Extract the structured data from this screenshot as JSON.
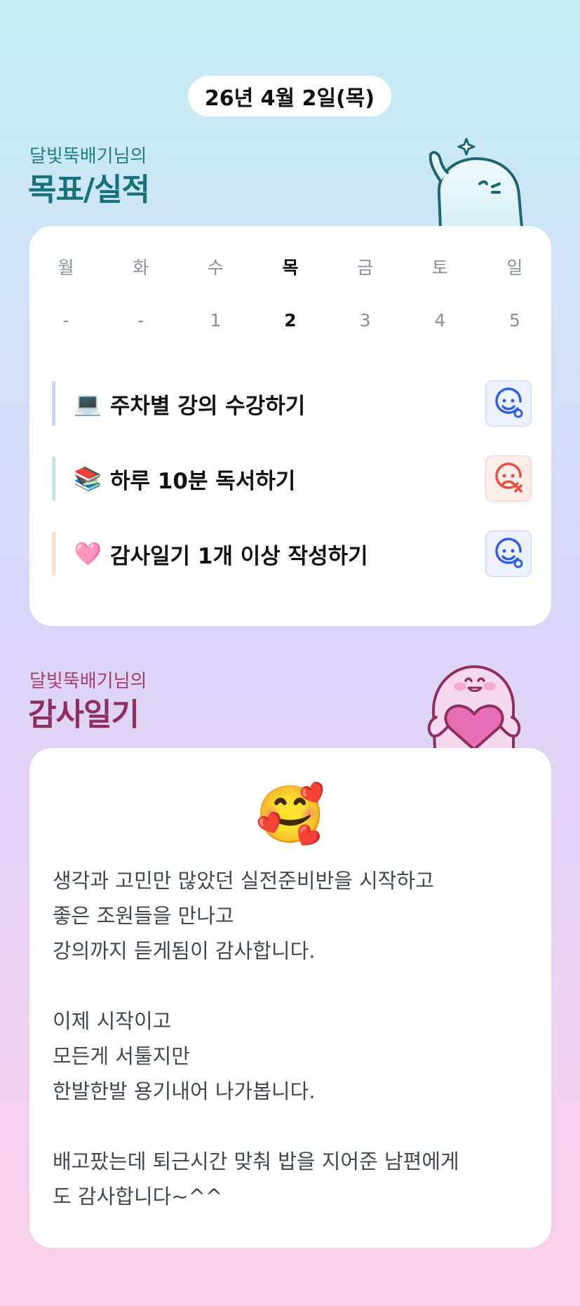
{
  "header": {
    "date": "26년 4월 2일(목)"
  },
  "goals_section": {
    "subtitle": "달빛뚝배기님의",
    "title": "목표/실적",
    "days": [
      {
        "label": "월",
        "date": "-"
      },
      {
        "label": "화",
        "date": "-"
      },
      {
        "label": "수",
        "date": "1"
      },
      {
        "label": "목",
        "date": "2",
        "active": true
      },
      {
        "label": "금",
        "date": "3"
      },
      {
        "label": "토",
        "date": "4"
      },
      {
        "label": "일",
        "date": "5"
      }
    ],
    "goals": [
      {
        "emoji": "💻",
        "text": "주차별 강의 수강하기",
        "status": "smile-check-icon",
        "bar_color": "#c8d3f5"
      },
      {
        "emoji": "📚",
        "text": "하루 10분 독서하기",
        "status": "frown-x-icon",
        "bar_color": "#bfe9df"
      },
      {
        "emoji": "🩷",
        "text": "감사일기 1개 이상 작성하기",
        "status": "smile-check-icon",
        "bar_color": "#fbe0c4"
      }
    ]
  },
  "diary_section": {
    "subtitle": "달빛뚝배기님의",
    "title": "감사일기",
    "emoji": "🥰",
    "text": "생각과 고민만 많았던 실전준비반을 시작하고\n좋은 조원들을 만나고\n강의까지 듣게됨이 감사합니다.\n\n이제 시작이고\n모든게 서툴지만\n한발한발 용기내어 나가봅니다.\n\n배고팠는데 퇴근시간 맞춰 밥을 지어준 남편에게\n도 감사합니다~^^"
  },
  "colors": {
    "accent_blue": "#2f5fe0",
    "fail_red": "#e4503a",
    "teal_title": "#1f7f86",
    "plum_title": "#8e2f5f"
  }
}
